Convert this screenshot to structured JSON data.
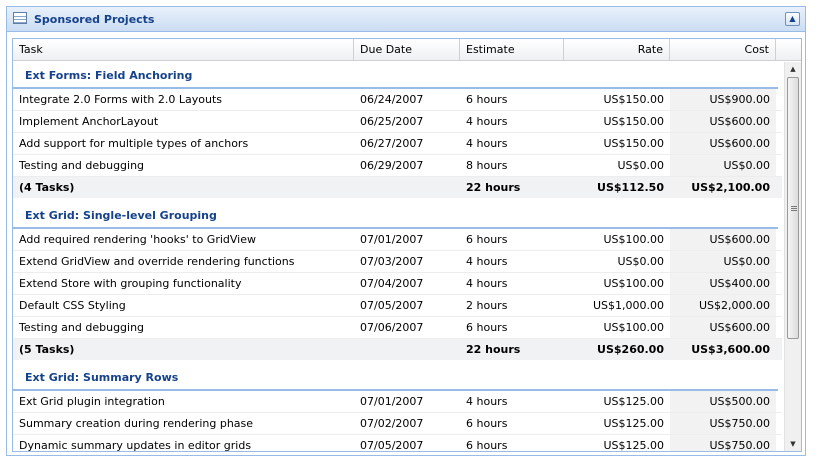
{
  "panel": {
    "title": "Sponsored Projects"
  },
  "columns": {
    "task": "Task",
    "due": "Due Date",
    "estimate": "Estimate",
    "rate": "Rate",
    "cost": "Cost"
  },
  "groups": [
    {
      "name": "Ext Forms: Field Anchoring",
      "rows": [
        {
          "task": "Integrate 2.0 Forms with 2.0 Layouts",
          "due": "06/24/2007",
          "estimate": "6 hours",
          "rate": "US$150.00",
          "cost": "US$900.00"
        },
        {
          "task": "Implement AnchorLayout",
          "due": "06/25/2007",
          "estimate": "4 hours",
          "rate": "US$150.00",
          "cost": "US$600.00"
        },
        {
          "task": "Add support for multiple types of anchors",
          "due": "06/27/2007",
          "estimate": "4 hours",
          "rate": "US$150.00",
          "cost": "US$600.00"
        },
        {
          "task": "Testing and debugging",
          "due": "06/29/2007",
          "estimate": "8 hours",
          "rate": "US$0.00",
          "cost": "US$0.00"
        }
      ],
      "summary": {
        "task": "(4 Tasks)",
        "estimate": "22 hours",
        "rate": "US$112.50",
        "cost": "US$2,100.00"
      }
    },
    {
      "name": "Ext Grid: Single-level Grouping",
      "rows": [
        {
          "task": "Add required rendering 'hooks' to GridView",
          "due": "07/01/2007",
          "estimate": "6 hours",
          "rate": "US$100.00",
          "cost": "US$600.00"
        },
        {
          "task": "Extend GridView and override rendering functions",
          "due": "07/03/2007",
          "estimate": "4 hours",
          "rate": "US$0.00",
          "cost": "US$0.00"
        },
        {
          "task": "Extend Store with grouping functionality",
          "due": "07/04/2007",
          "estimate": "4 hours",
          "rate": "US$100.00",
          "cost": "US$400.00"
        },
        {
          "task": "Default CSS Styling",
          "due": "07/05/2007",
          "estimate": "2 hours",
          "rate": "US$1,000.00",
          "cost": "US$2,000.00"
        },
        {
          "task": "Testing and debugging",
          "due": "07/06/2007",
          "estimate": "6 hours",
          "rate": "US$100.00",
          "cost": "US$600.00"
        }
      ],
      "summary": {
        "task": "(5 Tasks)",
        "estimate": "22 hours",
        "rate": "US$260.00",
        "cost": "US$3,600.00"
      }
    },
    {
      "name": "Ext Grid: Summary Rows",
      "rows": [
        {
          "task": "Ext Grid plugin integration",
          "due": "07/01/2007",
          "estimate": "4 hours",
          "rate": "US$125.00",
          "cost": "US$500.00"
        },
        {
          "task": "Summary creation during rendering phase",
          "due": "07/02/2007",
          "estimate": "6 hours",
          "rate": "US$125.00",
          "cost": "US$750.00"
        },
        {
          "task": "Dynamic summary updates in editor grids",
          "due": "07/05/2007",
          "estimate": "6 hours",
          "rate": "US$125.00",
          "cost": "US$750.00"
        }
      ]
    }
  ]
}
